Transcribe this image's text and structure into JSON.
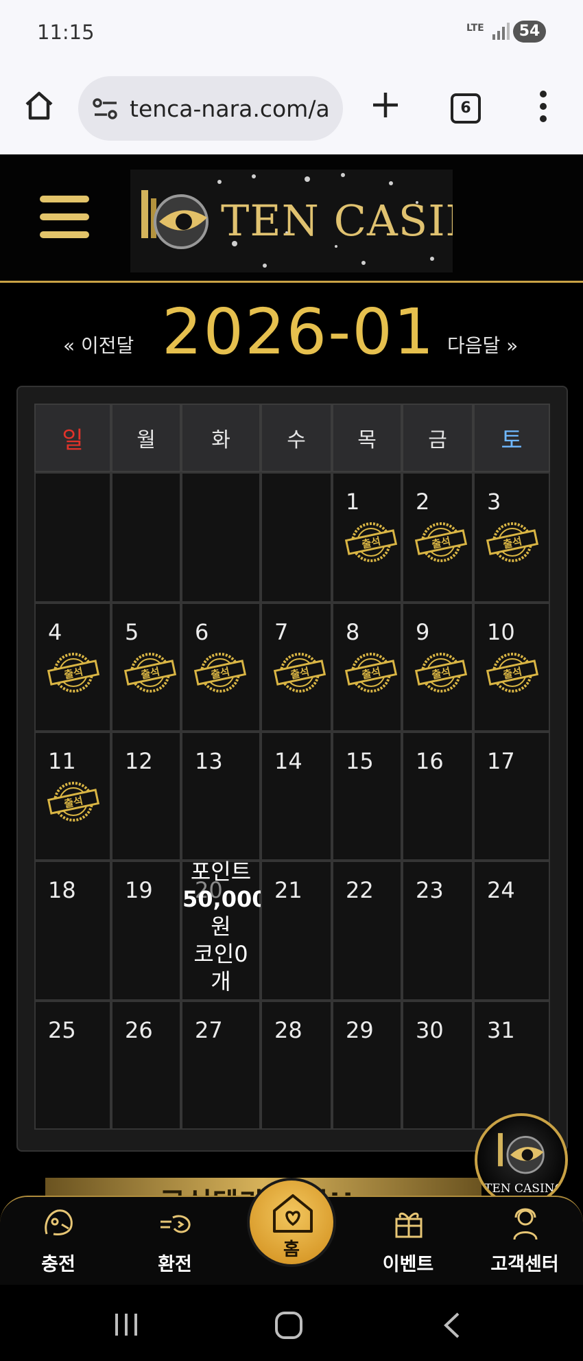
{
  "status_bar": {
    "time": "11:15",
    "network": "LTE",
    "battery": "54"
  },
  "browser": {
    "url": "tenca-nara.com/a",
    "tab_count": "6"
  },
  "site": {
    "logo_text": "TEN CASINO"
  },
  "calendar": {
    "prev_label": "« 이전달",
    "month": "2026-01",
    "next_label": "다음달 »",
    "weekdays": [
      "일",
      "월",
      "화",
      "수",
      "목",
      "금",
      "토"
    ],
    "weekday_colors": {
      "sunday": "#e0332a",
      "saturday": "#6fb8ff",
      "default": "#e6e6e6"
    },
    "weeks": [
      [
        "",
        "",
        "",
        "",
        "1",
        "2",
        "3"
      ],
      [
        "4",
        "5",
        "6",
        "7",
        "8",
        "9",
        "10"
      ],
      [
        "11",
        "12",
        "13",
        "14",
        "15",
        "16",
        "17"
      ],
      [
        "18",
        "19",
        "20",
        "21",
        "22",
        "23",
        "24"
      ],
      [
        "25",
        "26",
        "27",
        "28",
        "29",
        "30",
        "31"
      ]
    ],
    "attendance_days": [
      "1",
      "2",
      "3",
      "4",
      "5",
      "6",
      "7",
      "8",
      "9",
      "10",
      "11"
    ],
    "stamp_label": "출석",
    "accent_color": "#e6c04e"
  },
  "day_info": {
    "day": "20",
    "lines": [
      "포인트",
      "50,000",
      "원",
      "코인0",
      "개"
    ]
  },
  "banner": {
    "text": "공식텐카 개업!!"
  },
  "float_logo": {
    "text": "TEN CASINO"
  },
  "bottom_nav": {
    "items": [
      {
        "label": "충전",
        "icon": "charge-icon"
      },
      {
        "label": "환전",
        "icon": "exchange-icon"
      },
      {
        "label": "홈",
        "icon": "home-heart-icon"
      },
      {
        "label": "이벤트",
        "icon": "gift-icon"
      },
      {
        "label": "고객센터",
        "icon": "support-icon"
      }
    ]
  }
}
